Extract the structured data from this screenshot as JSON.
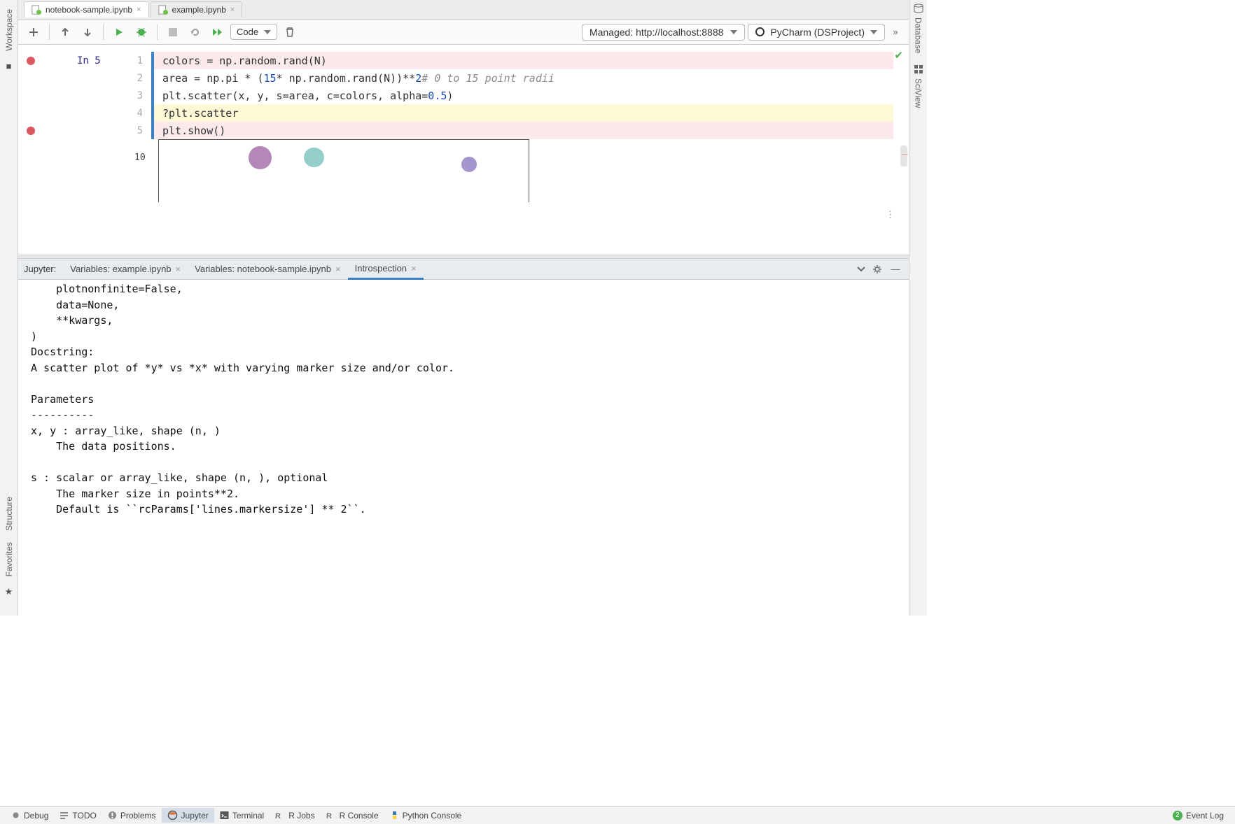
{
  "tabs": [
    {
      "label": "notebook-sample.ipynb",
      "active": true
    },
    {
      "label": "example.ipynb",
      "active": false
    }
  ],
  "toolbar": {
    "cell_type": "Code",
    "server": "Managed: http://localhost:8888",
    "interpreter": "PyCharm (DSProject)"
  },
  "cell": {
    "in_label": "In 5",
    "lines": [
      {
        "n": 1,
        "html": "colors = np.random.rand(N)",
        "bp": true,
        "hl": false
      },
      {
        "n": 2,
        "html": "area = np.pi * (<span class='tok-n'>15</span> * np.random.rand(N))**<span class='tok-n'>2</span>   <span class='tok-c'># 0 to 15 point radii</span>",
        "bp": false,
        "hl": false
      },
      {
        "n": 3,
        "html": "plt.scatter(x, y, s=area, c=colors, alpha=<span class='tok-n'>0.5</span>)",
        "bp": false,
        "hl": false
      },
      {
        "n": 4,
        "html": "?plt.scatter",
        "bp": false,
        "hl": true
      },
      {
        "n": 5,
        "html": "plt.show()",
        "bp": true,
        "hl": false
      }
    ]
  },
  "panel": {
    "prefix": "Jupyter:",
    "tabs": [
      {
        "label": "Variables: example.ipynb",
        "closable": true,
        "active": false
      },
      {
        "label": "Variables: notebook-sample.ipynb",
        "closable": true,
        "active": false
      },
      {
        "label": "Introspection",
        "closable": true,
        "active": true
      }
    ],
    "introspection_text": "    plotnonfinite=False,\n    data=None,\n    **kwargs,\n)\nDocstring:\nA scatter plot of *y* vs *x* with varying marker size and/or color.\n\nParameters\n----------\nx, y : array_like, shape (n, )\n    The data positions.\n\ns : scalar or array_like, shape (n, ), optional\n    The marker size in points**2.\n    Default is ``rcParams['lines.markersize'] ** 2``."
  },
  "left_sidebar": {
    "items": [
      {
        "label": "Workspace",
        "name": "workspace"
      },
      {
        "label": "Structure",
        "name": "structure"
      },
      {
        "label": "Favorites",
        "name": "favorites"
      }
    ]
  },
  "right_sidebar": {
    "items": [
      {
        "label": "Database",
        "name": "database"
      },
      {
        "label": "SciView",
        "name": "sciview"
      }
    ]
  },
  "status_bar": {
    "items": [
      {
        "label": "Debug",
        "name": "debug"
      },
      {
        "label": "TODO",
        "name": "todo"
      },
      {
        "label": "Problems",
        "name": "problems"
      },
      {
        "label": "Jupyter",
        "name": "jupyter",
        "active": true
      },
      {
        "label": "Terminal",
        "name": "terminal"
      },
      {
        "label": "R Jobs",
        "name": "r-jobs"
      },
      {
        "label": "R Console",
        "name": "r-console"
      },
      {
        "label": "Python Console",
        "name": "python-console"
      }
    ],
    "event_log": {
      "count": "2",
      "label": "Event Log"
    }
  },
  "chart_data": {
    "type": "scatter",
    "title": "",
    "xlabel": "",
    "ylabel": "",
    "ylim": [
      0,
      11
    ],
    "points": [
      {
        "x": 3.0,
        "y": 10.0,
        "size": 170,
        "color": "#a06aa8"
      },
      {
        "x": 4.6,
        "y": 10.1,
        "size": 130,
        "color": "#79c2bd"
      },
      {
        "x": 9.2,
        "y": 8.6,
        "size": 80,
        "color": "#8d7bc0"
      }
    ],
    "y_ticks": [
      10
    ]
  }
}
